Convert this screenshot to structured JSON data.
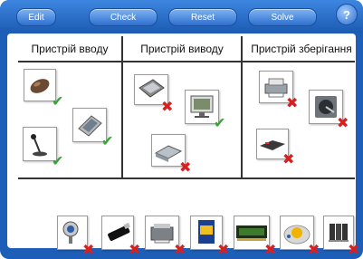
{
  "toolbar": {
    "edit_label": "Edit",
    "check_label": "Check",
    "reset_label": "Reset",
    "solve_label": "Solve",
    "help_label": "?"
  },
  "columns": {
    "input": "Пристрій вводу",
    "output": "Пристрій виводу",
    "storage": "Пристрій зберігання"
  },
  "marks": {
    "correct": "✔",
    "wrong": "✖"
  },
  "colors": {
    "frame": "#1d5fb8",
    "correct": "#3aa33a",
    "wrong": "#d82020"
  }
}
